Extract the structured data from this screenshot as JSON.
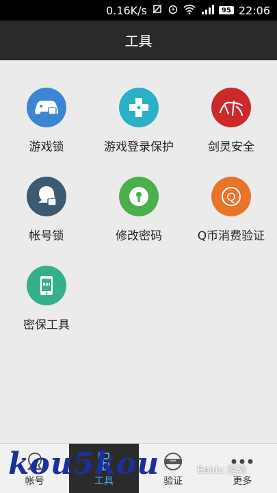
{
  "status_bar": {
    "net_speed": "0.16K/s",
    "battery_level": "95",
    "time": "22:06",
    "icons": [
      "silent-icon",
      "alarm-icon",
      "wifi-icon",
      "signal-icon",
      "battery-icon"
    ]
  },
  "header": {
    "title": "工具"
  },
  "tools": [
    {
      "label": "游戏锁",
      "icon": "gamepad-lock-icon",
      "color": "#3a86d4"
    },
    {
      "label": "游戏登录保护",
      "icon": "dpad-icon",
      "color": "#2bb0c8"
    },
    {
      "label": "剑灵安全",
      "icon": "jianling-logo-icon",
      "color": "#cc2a2a"
    },
    {
      "label": "帐号锁",
      "icon": "user-lock-icon",
      "color": "#3c5a72"
    },
    {
      "label": "修改密码",
      "icon": "keyhole-icon",
      "color": "#4bb04b"
    },
    {
      "label": "Q币消费验证",
      "icon": "q-coin-icon",
      "color": "#e8742a"
    },
    {
      "label": "密保工具",
      "icon": "phone-token-icon",
      "color": "#36b08a"
    }
  ],
  "tabbar": {
    "items": [
      {
        "label": "帐号",
        "icon": "account-icon"
      },
      {
        "label": "工具",
        "icon": "tools-icon",
        "active": true
      },
      {
        "label": "验证",
        "icon": "verify-icon"
      },
      {
        "label": "更多",
        "icon": "more-icon"
      }
    ]
  },
  "overlays": {
    "watermark": "kou5kou",
    "baidu_mark": "Baidu 经验"
  }
}
